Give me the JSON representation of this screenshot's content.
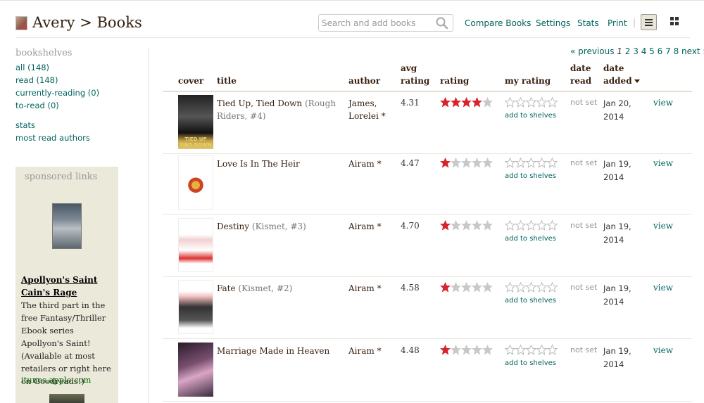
{
  "header": {
    "user": "Avery",
    "separator": ">",
    "section": "Books",
    "search_placeholder": "Search and add books",
    "nav": [
      "Compare Books",
      "Settings",
      "Stats",
      "Print"
    ],
    "nav_separator": "|"
  },
  "sidebar": {
    "heading": "bookshelves",
    "shelves": [
      "all (148)",
      "read (148)",
      "currently-reading (0)",
      "to-read (0)"
    ],
    "links": [
      "stats",
      "most read authors"
    ]
  },
  "sponsor": {
    "heading": "sponsored links",
    "title": "Apollyon's Saint Cain's Rage",
    "body": "The third part in the free Fantasy/Thriller Ebook series Apollyon's Saint! (Available at most retailers or right here on Goodreads!)",
    "url": "itunes.apple.com"
  },
  "pager": {
    "prev": "« previous",
    "current": "1",
    "pages": [
      "2",
      "3",
      "4",
      "5",
      "6",
      "7",
      "8"
    ],
    "next": "next »"
  },
  "columns": {
    "cover": "cover",
    "title": "title",
    "author": "author",
    "avg_rating_1": "avg",
    "avg_rating_2": "rating",
    "rating": "rating",
    "my_rating": "my rating",
    "date_read_1": "date",
    "date_read_2": "read",
    "date_added_1": "date",
    "date_added_2": "added"
  },
  "colors": {
    "star_on": "#d8232a",
    "star_off": "#c8c8c8",
    "link": "#00635d",
    "brown": "#382110"
  },
  "books": [
    {
      "title": "Tied Up, Tied Down",
      "series": "(Rough Riders, #4)",
      "author": "James, Lorelei",
      "author_mark": "*",
      "avg": "4.31",
      "rating": 4,
      "cover_text": "TIED UP TIED DOWN",
      "add_label": "add to shelves",
      "date_read": "not set",
      "date_added": "Jan 20, 2014",
      "view": "view"
    },
    {
      "title": "Love Is In The Heir",
      "series": "",
      "author": "Airam",
      "author_mark": "*",
      "avg": "4.47",
      "rating": 1,
      "cover_text": "",
      "add_label": "add to shelves",
      "date_read": "not set",
      "date_added": "Jan 19, 2014",
      "view": "view"
    },
    {
      "title": "Destiny",
      "series": "(Kismet, #3)",
      "author": "Airam",
      "author_mark": "*",
      "avg": "4.70",
      "rating": 1,
      "cover_text": "",
      "add_label": "add to shelves",
      "date_read": "not set",
      "date_added": "Jan 19, 2014",
      "view": "view"
    },
    {
      "title": "Fate",
      "series": "(Kismet, #2)",
      "author": "Airam",
      "author_mark": "*",
      "avg": "4.58",
      "rating": 1,
      "cover_text": "",
      "add_label": "add to shelves",
      "date_read": "not set",
      "date_added": "Jan 19, 2014",
      "view": "view"
    },
    {
      "title": "Marriage Made in Heaven",
      "series": "",
      "author": "Airam",
      "author_mark": "*",
      "avg": "4.48",
      "rating": 1,
      "cover_text": "",
      "add_label": "add to shelves",
      "date_read": "not set",
      "date_added": "Jan 19, 2014",
      "view": "view"
    }
  ]
}
